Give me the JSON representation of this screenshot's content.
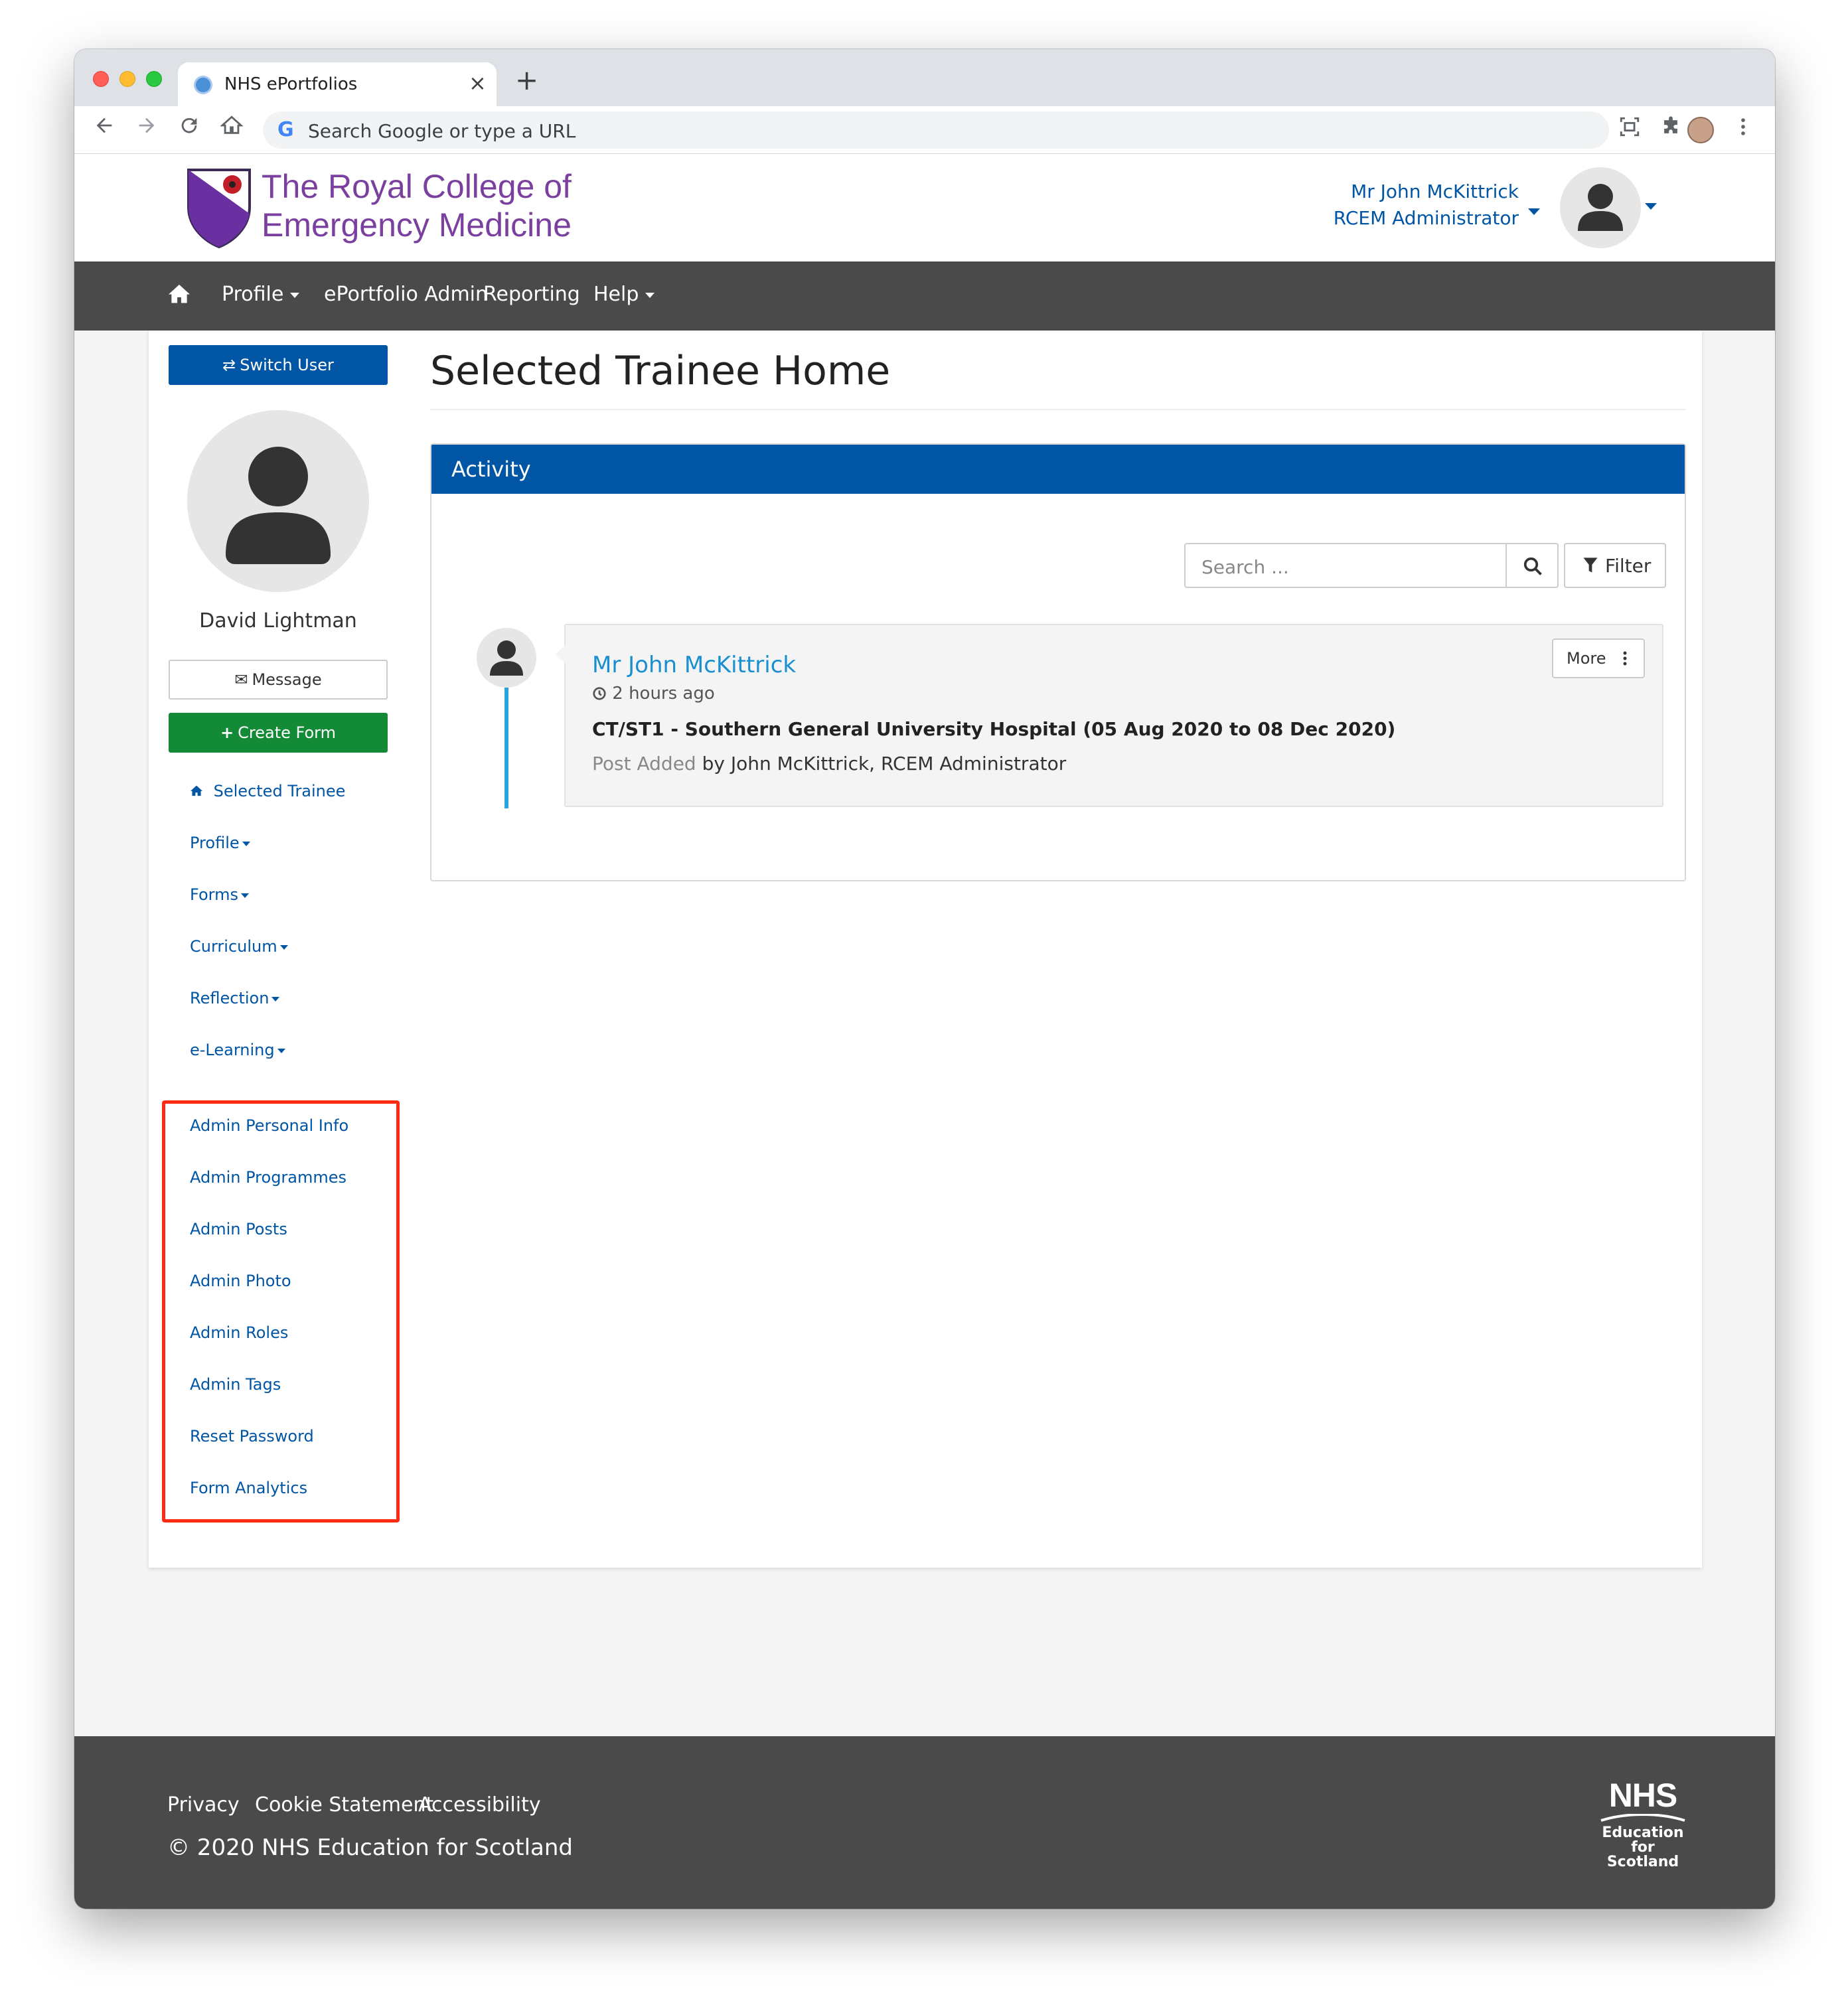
{
  "browser": {
    "tab_title": "NHS ePortfolios",
    "tab_close": "×",
    "new_tab": "+",
    "omnibox_placeholder": "Search Google or type a URL",
    "google_g": "G"
  },
  "header": {
    "logo_line1": "The Royal College of",
    "logo_line2": "Emergency Medicine",
    "user_name": "Mr John McKittrick",
    "user_role": "RCEM Administrator"
  },
  "navbar": {
    "items": [
      "Profile",
      "ePortfolio Admin",
      "Reporting",
      "Help"
    ]
  },
  "sidebar": {
    "switch_user": "Switch User",
    "trainee_name": "David Lightman",
    "message": "Message",
    "create_form": "Create Form",
    "links": [
      "Selected Trainee",
      "Profile",
      "Forms",
      "Curriculum",
      "Reflection",
      "e-Learning"
    ],
    "admin_links": [
      "Admin Personal Info",
      "Admin Programmes",
      "Admin Posts",
      "Admin Photo",
      "Admin Roles",
      "Admin Tags",
      "Reset Password",
      "Form Analytics"
    ]
  },
  "main": {
    "title": "Selected Trainee Home",
    "panel_title": "Activity",
    "search_placeholder": "Search ...",
    "filter_label": "Filter",
    "activity": {
      "author": "Mr John McKittrick",
      "time": "2 hours ago",
      "title": "CT/ST1 - Southern General University Hospital (05 Aug 2020 to 08 Dec 2020)",
      "action": "Post Added",
      "by": "by John McKittrick, RCEM Administrator",
      "more_label": "More"
    }
  },
  "footer": {
    "links": [
      "Privacy",
      "Cookie Statement",
      "Accessibility"
    ],
    "copyright": "© 2020 NHS Education for Scotland",
    "nhs_mark": "NHS",
    "nhs_line1": "Education",
    "nhs_line2": "for",
    "nhs_line3": "Scotland"
  },
  "colors": {
    "brand_blue": "#0055a5",
    "nav_gray": "#4a4a4a",
    "create_green": "#138a36",
    "logo_purple": "#7b3fa0",
    "highlight_red": "#ff2a14",
    "link_cyan": "#1a8fd0"
  }
}
